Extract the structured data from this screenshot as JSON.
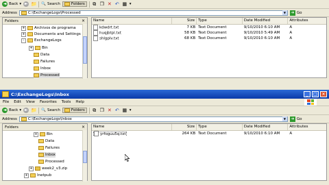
{
  "window1": {
    "toolbar": {
      "back": "Back",
      "search": "Search",
      "folders": "Folders"
    },
    "address": {
      "label": "Address",
      "path": "C:\\ExchangeLogs\\Processed",
      "go": "Go"
    },
    "folders_header": "Folders",
    "tree": [
      {
        "label": "Archivos de programa",
        "expander": "+"
      },
      {
        "label": "Documents and Settings",
        "expander": "+"
      },
      {
        "label": "ExchangeLogs",
        "expander": "-"
      },
      {
        "label": "Bin",
        "expander": "+"
      },
      {
        "label": "Data",
        "expander": ""
      },
      {
        "label": "Failures",
        "expander": ""
      },
      {
        "label": "Inbox",
        "expander": ""
      },
      {
        "label": "Processed",
        "expander": ""
      }
    ],
    "columns": [
      "Name",
      "Size",
      "Type",
      "Date Modified",
      "Attributes"
    ],
    "files": [
      {
        "name": "kdwdrt.txt",
        "size": "7 KB",
        "type": "Text Document",
        "date": "9/10/2010 6:10 AM",
        "attr": "A"
      },
      {
        "name": "huqjbtpl.txt",
        "size": "58 KB",
        "type": "Text Document",
        "date": "9/10/2010 5:49 AM",
        "attr": "A"
      },
      {
        "name": "shlgplv.txt",
        "size": "68 KB",
        "type": "Text Document",
        "date": "9/10/2010 6:10 AM",
        "attr": "A"
      }
    ]
  },
  "window2": {
    "title": "C:\\ExchangeLogs\\Inbox",
    "menu": [
      "File",
      "Edit",
      "View",
      "Favorites",
      "Tools",
      "Help"
    ],
    "toolbar": {
      "back": "Back",
      "search": "Search",
      "folders": "Folders"
    },
    "address": {
      "label": "Address",
      "path": "C:\\ExchangeLogs\\Inbox",
      "go": "Go"
    },
    "folders_header": "Folders",
    "tree": [
      {
        "label": "Bin",
        "expander": "+"
      },
      {
        "label": "Data",
        "expander": ""
      },
      {
        "label": "Failures",
        "expander": ""
      },
      {
        "label": "Inbox",
        "expander": ""
      },
      {
        "label": "Processed",
        "expander": ""
      },
      {
        "label": "week2_v3.zip",
        "expander": "+"
      },
      {
        "label": "Inetpub",
        "expander": "+"
      }
    ],
    "columns": [
      "Name",
      "Size",
      "Type",
      "Date Modified",
      "Attributes"
    ],
    "files": [
      {
        "name": "yrfoguu5q.txt",
        "size": "264 KB",
        "type": "Text Document",
        "date": "9/10/2010 6:10 AM",
        "attr": "A"
      }
    ]
  },
  "colors": {
    "titlebar": "#0a3aa8",
    "folder": "#f3cf55",
    "selection": "#dedede"
  }
}
